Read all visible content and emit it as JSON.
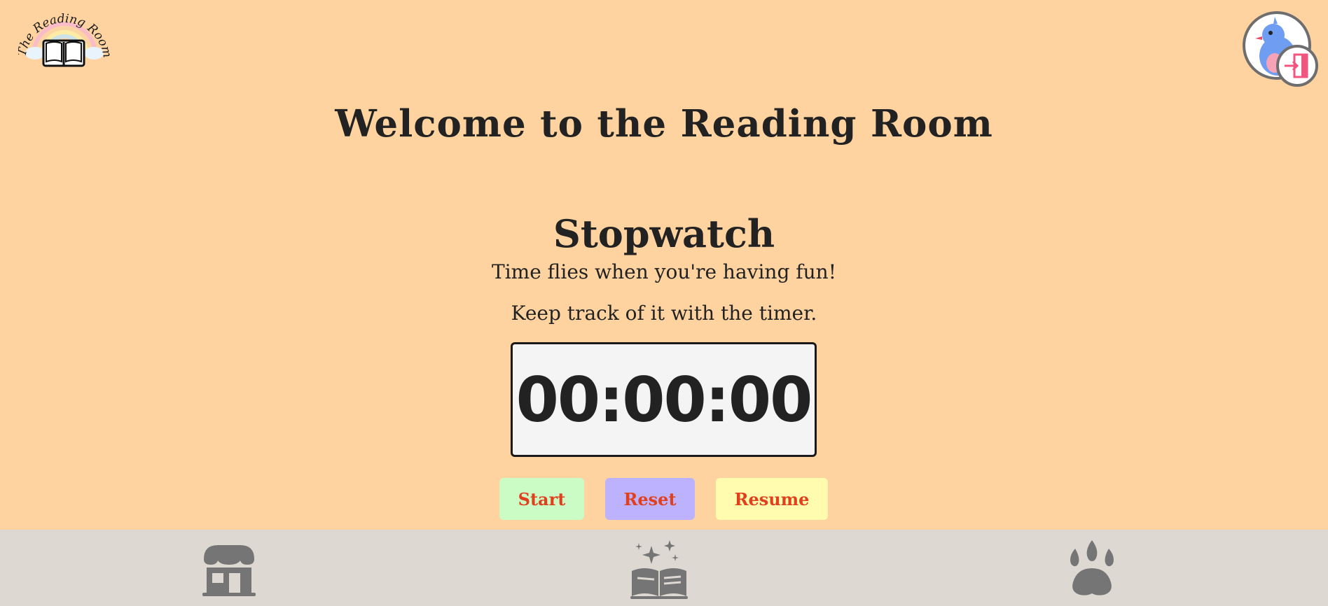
{
  "app": {
    "logo_text": "The Reading Room",
    "logo_icon": "open-book-rainbow-logo"
  },
  "header": {
    "title": "Welcome to the Reading Room",
    "profile_icon": "bird-avatar",
    "logout_icon": "logout-door-icon"
  },
  "stopwatch": {
    "title": "Stopwatch",
    "tagline_1": "Time flies when you're having fun!",
    "tagline_2": "Keep track of it with the timer.",
    "time": "00:00:00",
    "buttons": {
      "start": "Start",
      "reset": "Reset",
      "resume": "Resume"
    }
  },
  "bottom_nav": {
    "items": [
      {
        "icon": "shop-icon"
      },
      {
        "icon": "magic-book-icon"
      },
      {
        "icon": "paw-icon"
      }
    ]
  },
  "colors": {
    "background": "#FED3A0",
    "nav_background": "#DDD8D1",
    "button_text": "#E0401E",
    "start_button": "#CBFCC5",
    "reset_button": "#BDB2FE",
    "resume_button": "#FFFCAF",
    "icon_gray": "#757575"
  }
}
